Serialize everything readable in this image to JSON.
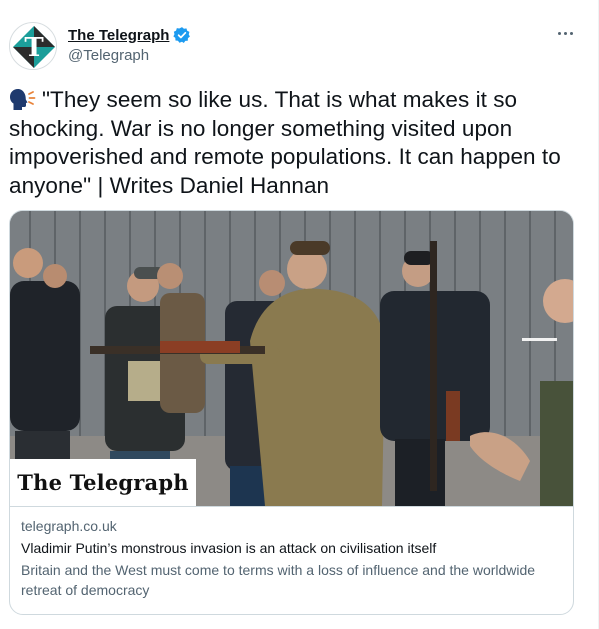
{
  "tweet": {
    "author": {
      "display_name": "The Telegraph",
      "handle": "@Telegraph",
      "verified": true,
      "avatar_icon": "telegraph-t-logo",
      "avatar_colors": [
        "#1b9e9a",
        "#2c2c2c"
      ]
    },
    "more_icon": "more-horizontal-icon",
    "text_emoji": "speaking-head-emoji",
    "text": "\"They seem so like us. That is what makes it so shocking. War is no longer something visited upon impoverished and remote populations. It can happen to anyone\" | Writes Daniel Hannan",
    "card": {
      "logo_text": "The Telegraph",
      "domain": "telegraph.co.uk",
      "title": "Vladimir Putin’s monstrous invasion is an attack on civilisation itself",
      "description": "Britain and the West must come to terms with a loss of influence and the worldwide retreat of democracy"
    }
  },
  "colors": {
    "verified_blue": "#1d9bf0",
    "secondary_text": "#536471",
    "border": "#cfd9de"
  }
}
